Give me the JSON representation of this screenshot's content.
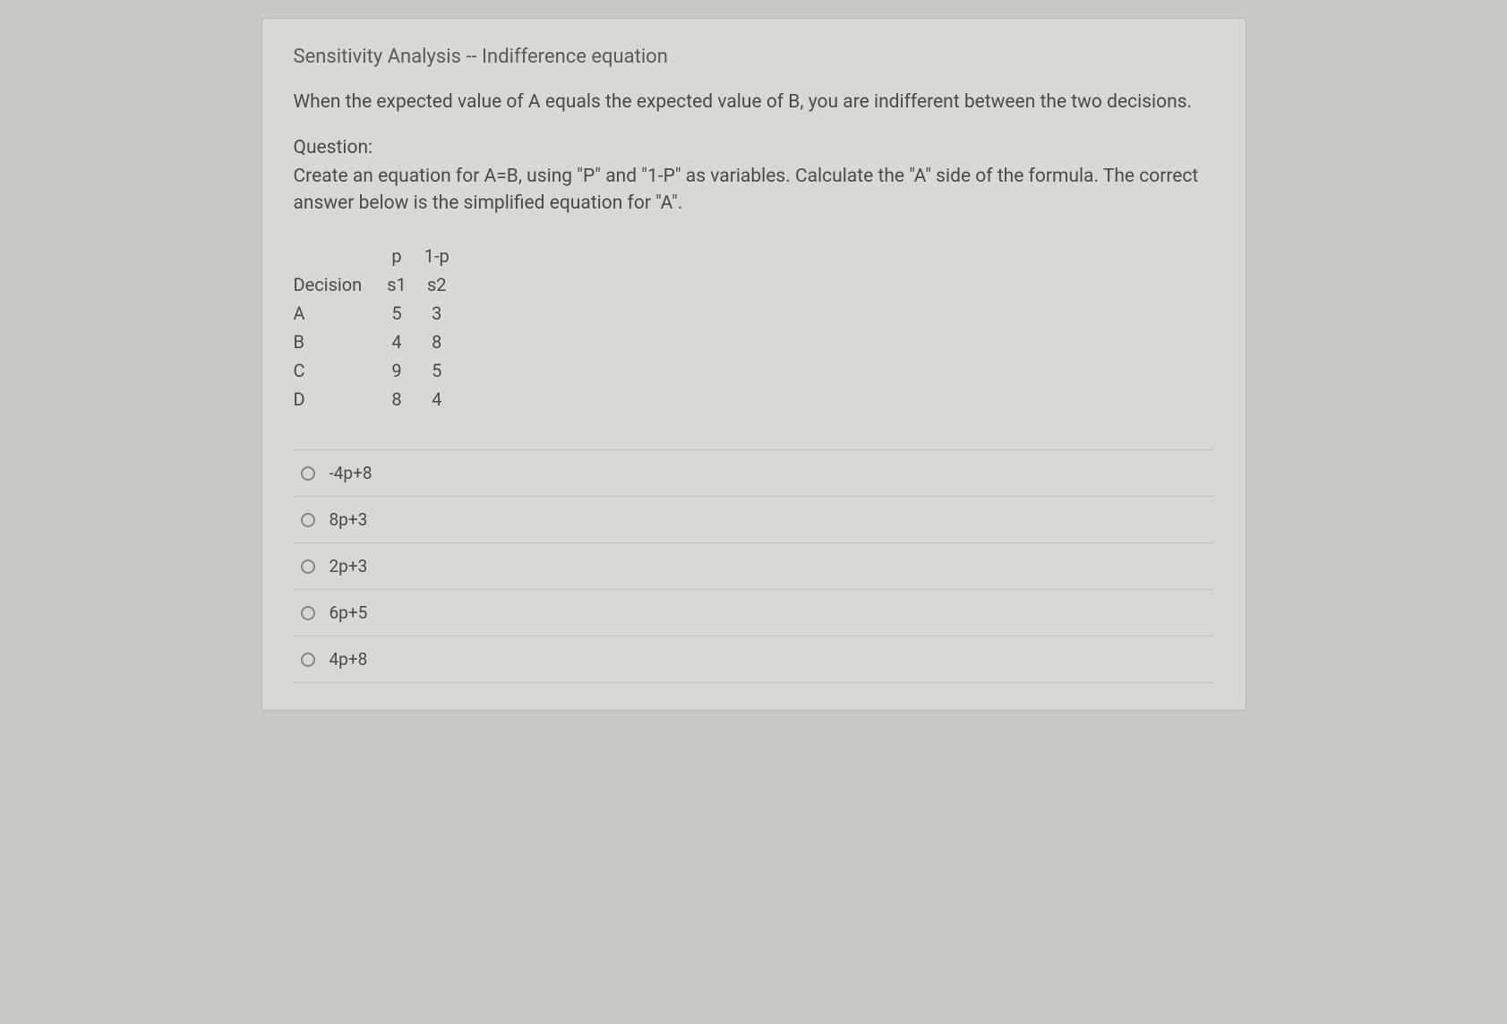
{
  "title": "Sensitivity Analysis -- Indifference equation",
  "intro": "When the expected value of A equals the expected value of B, you are indifferent between the two decisions.",
  "question_label": "Question:",
  "question_text": "Create an equation for A=B, using \"P\" and \"1-P\" as variables. Calculate the \"A\" side of the formula. The correct answer below is the simplified equation for \"A\".",
  "table": {
    "header_probs": [
      "",
      "p",
      "1-p"
    ],
    "header_states": [
      "Decision",
      "s1",
      "s2"
    ],
    "rows": [
      {
        "label": "A",
        "s1": "5",
        "s2": "3"
      },
      {
        "label": "B",
        "s1": "4",
        "s2": "8"
      },
      {
        "label": "C",
        "s1": "9",
        "s2": "5"
      },
      {
        "label": "D",
        "s1": "8",
        "s2": "4"
      }
    ]
  },
  "options": [
    {
      "label": "-4p+8"
    },
    {
      "label": "8p+3"
    },
    {
      "label": "2p+3"
    },
    {
      "label": "6p+5"
    },
    {
      "label": "4p+8"
    }
  ]
}
